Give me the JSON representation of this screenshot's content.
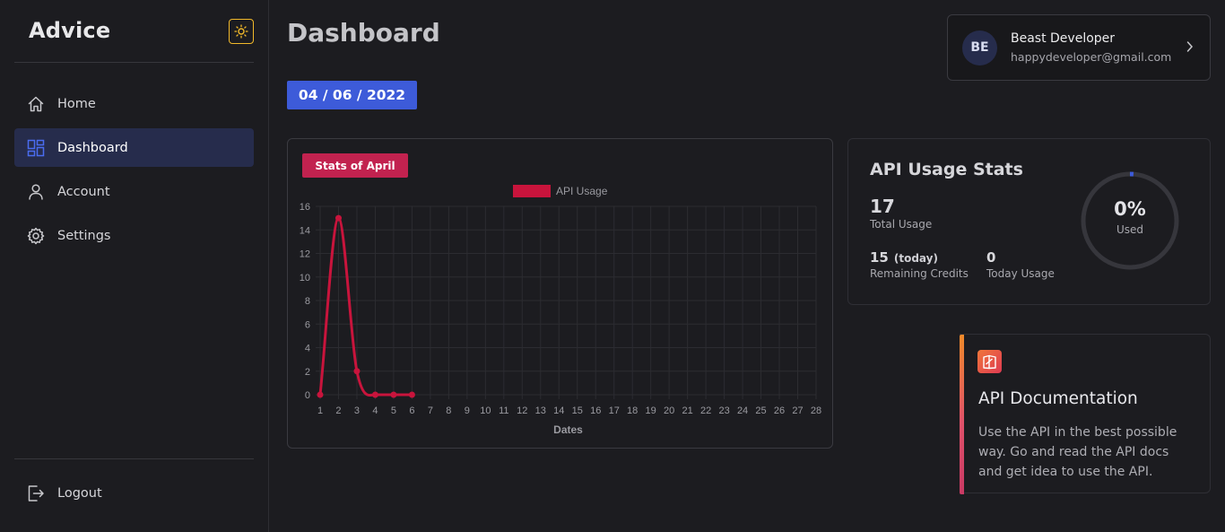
{
  "sidebar": {
    "brand": "Advice",
    "items": [
      {
        "label": "Home",
        "icon": "home-icon",
        "active": false
      },
      {
        "label": "Dashboard",
        "icon": "dashboard-icon",
        "active": true
      },
      {
        "label": "Account",
        "icon": "user-icon",
        "active": false
      },
      {
        "label": "Settings",
        "icon": "gear-icon",
        "active": false
      }
    ],
    "logout_label": "Logout"
  },
  "header": {
    "title": "Dashboard",
    "date": "04 / 06 / 2022"
  },
  "user": {
    "initials": "BE",
    "name": "Beast Developer",
    "email": "happydeveloper@gmail.com"
  },
  "chart_card": {
    "tag": "Stats of April"
  },
  "chart_data": {
    "type": "line",
    "title": "",
    "xlabel": "Dates",
    "ylabel": "",
    "legend": "top",
    "grid": true,
    "ylim": [
      0,
      16
    ],
    "y_ticks": [
      0,
      2,
      4,
      6,
      8,
      10,
      12,
      14,
      16
    ],
    "categories": [
      "1",
      "2",
      "3",
      "4",
      "5",
      "6",
      "7",
      "8",
      "9",
      "10",
      "11",
      "12",
      "13",
      "14",
      "15",
      "16",
      "17",
      "18",
      "19",
      "20",
      "21",
      "22",
      "23",
      "24",
      "25",
      "26",
      "27",
      "28"
    ],
    "series": [
      {
        "name": "API Usage",
        "color": "#c8143c",
        "values": [
          0,
          15,
          2,
          0,
          0,
          0
        ]
      }
    ]
  },
  "api_stats": {
    "title": "API Usage Stats",
    "total_value": "17",
    "total_label": "Total Usage",
    "remaining_value": "15",
    "remaining_tag": "(today)",
    "remaining_label": "Remaining Credits",
    "today_value": "0",
    "today_label": "Today Usage",
    "used_percent": "0%",
    "used_label": "Used",
    "used_fraction": 0.0
  },
  "docs": {
    "title": "API Documentation",
    "text": "Use the API in the best possible way. Go and read the API docs and get idea to use the API."
  },
  "colors": {
    "accent": "#3d5bd9",
    "tag": "#c2224f",
    "theme_toggle": "#f2b92a"
  }
}
